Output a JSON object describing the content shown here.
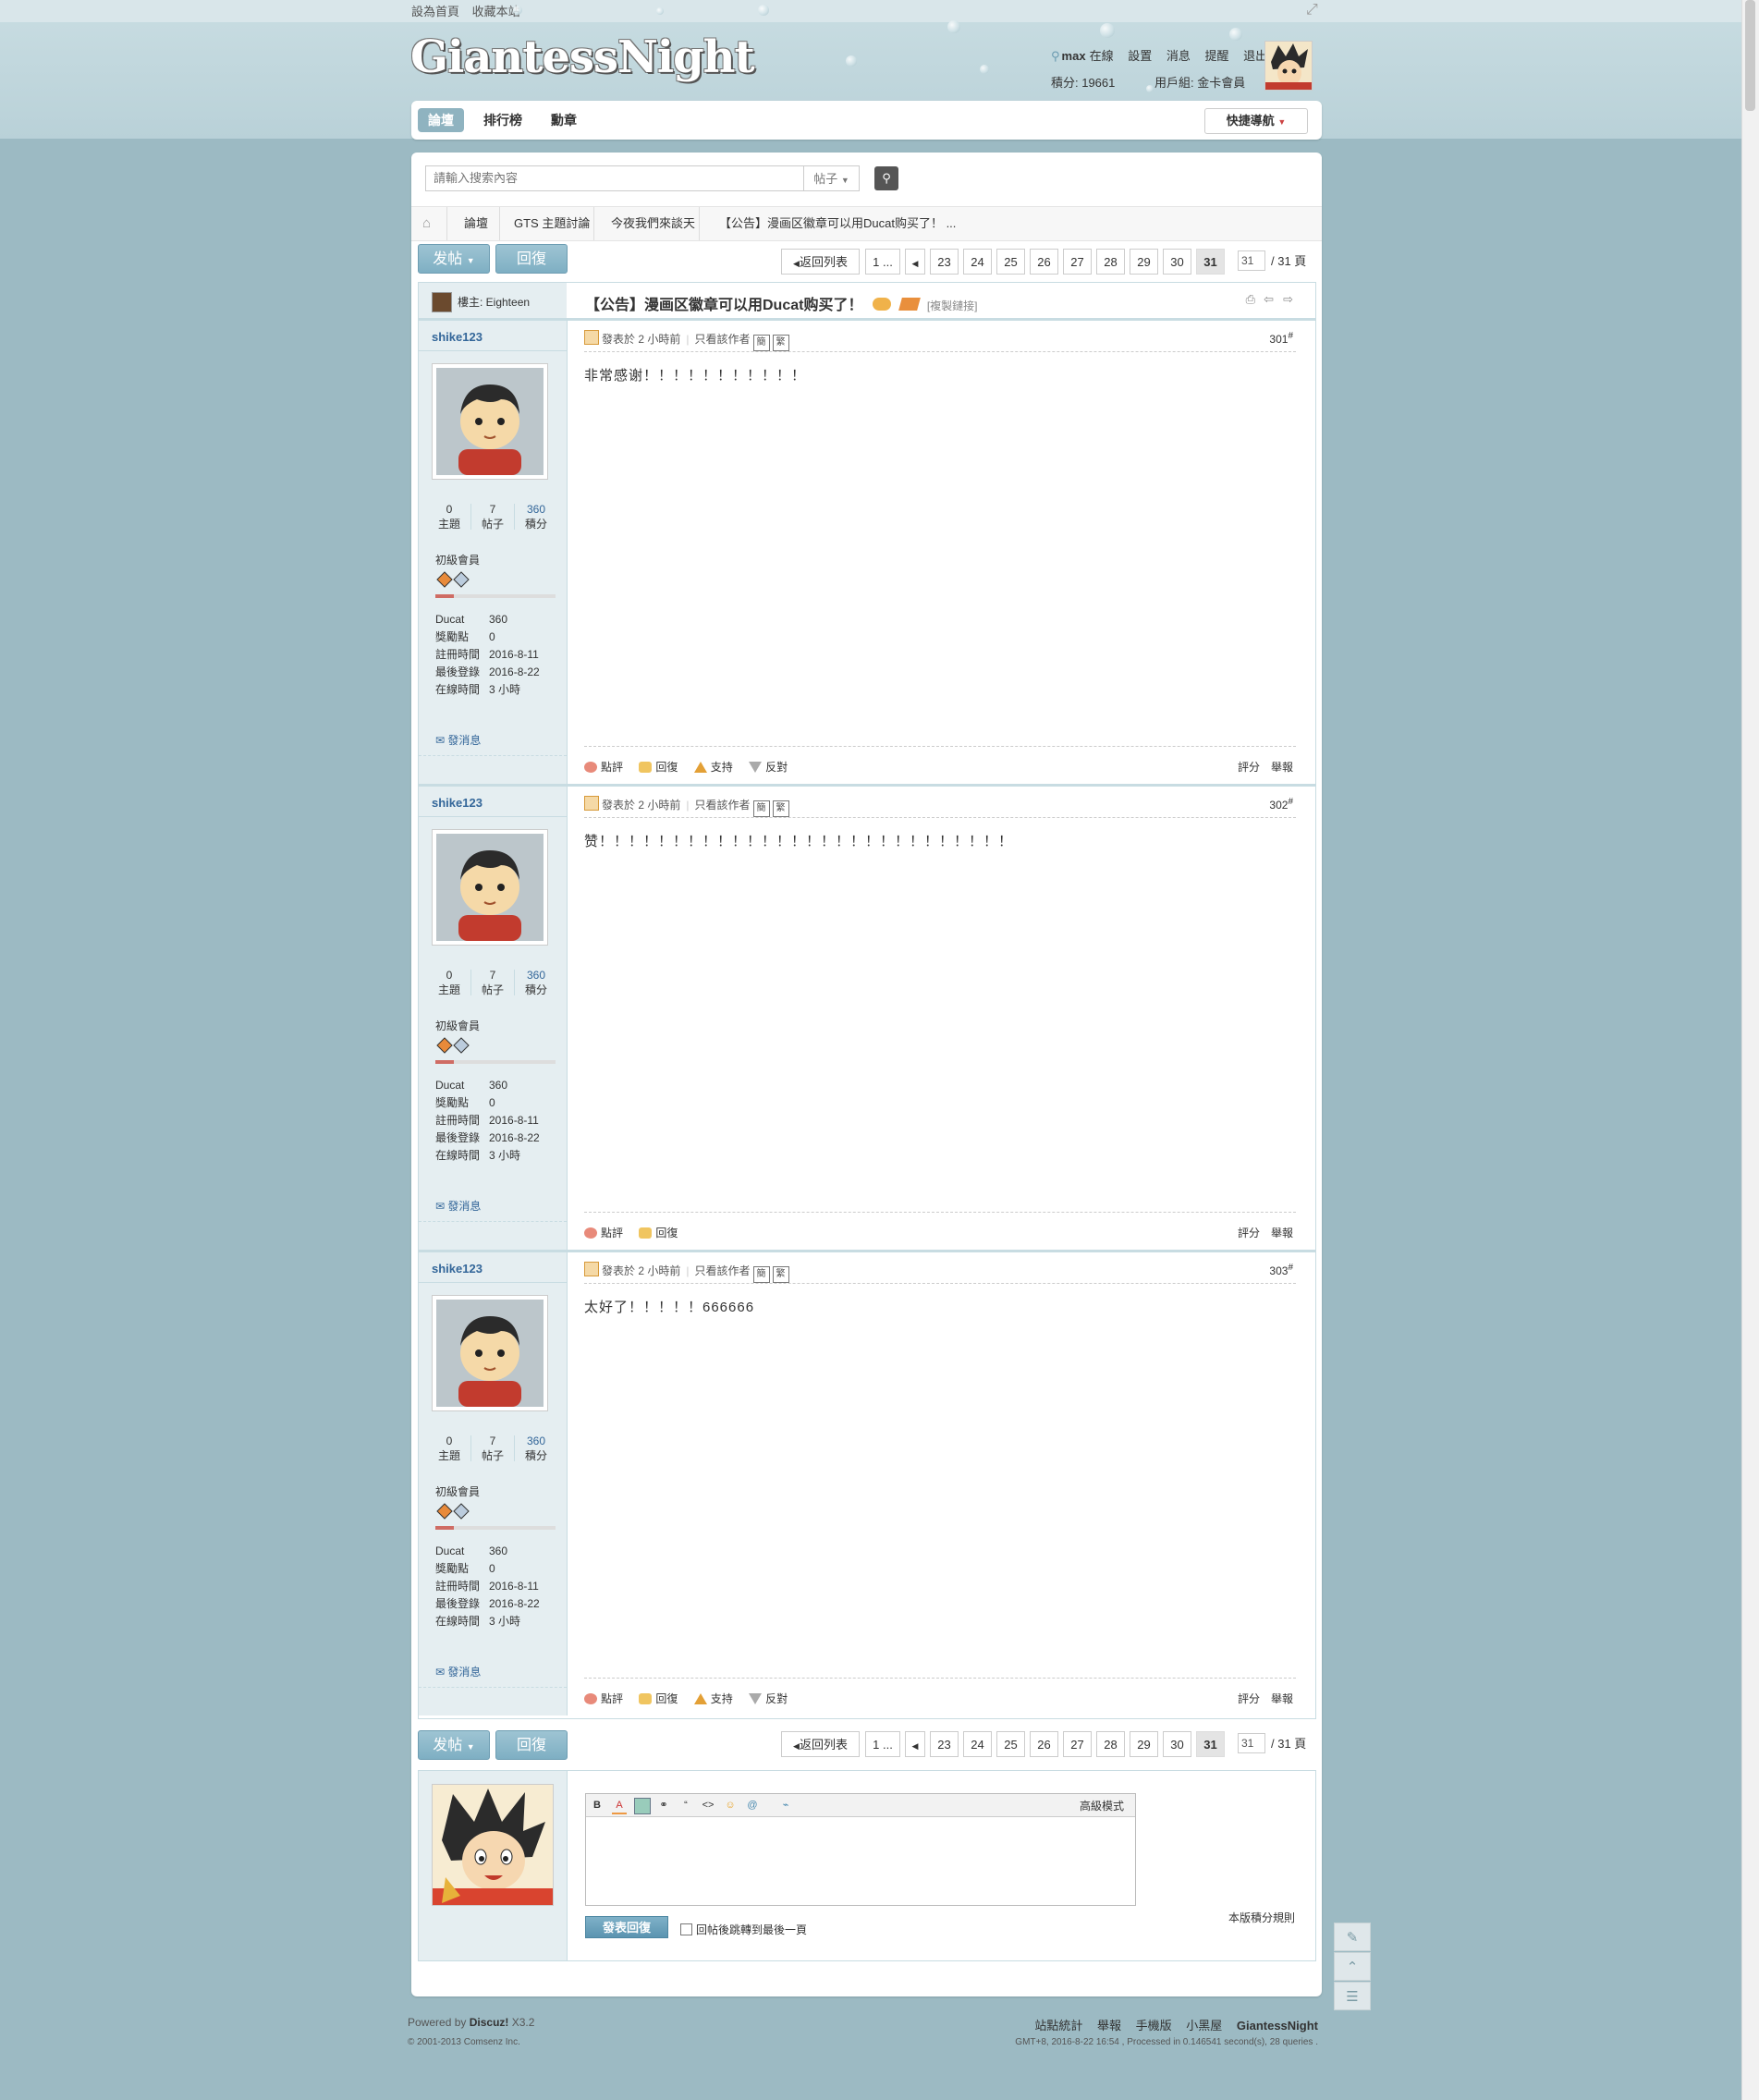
{
  "toplinks": [
    "設為首頁",
    "收藏本站"
  ],
  "site_logo": "GiantessNight",
  "user": {
    "name": "max",
    "status": "在線",
    "links": [
      "設置",
      "消息",
      "提醒",
      "退出"
    ],
    "credits": "積分: 19661",
    "group": "用戶組: 金卡會員"
  },
  "nav": {
    "tabs": [
      "論壇",
      "排行榜",
      "勳章"
    ],
    "quick_nav": "快捷導航"
  },
  "search": {
    "placeholder": "請輸入搜索內容",
    "type": "帖子"
  },
  "breadcrumb": [
    "論壇",
    "GTS 主題討論",
    "今夜我們來談天",
    "【公告】漫画区徽章可以用Ducat购买了！ ..."
  ],
  "buttons": {
    "post": "发帖",
    "reply": "回復"
  },
  "pager": {
    "back": "返回列表",
    "first": "1 ...",
    "pages": [
      "23",
      "24",
      "25",
      "26",
      "27",
      "28",
      "29",
      "30",
      "31"
    ],
    "current": "31",
    "input": "31",
    "total": "/ 31 頁"
  },
  "thread": {
    "host": "樓主: Eighteen",
    "title": "【公告】漫画区徽章可以用Ducat购买了！",
    "copy_link": "[複製鏈接]"
  },
  "posts": [
    {
      "author": "shike123",
      "stats": {
        "threads": "0",
        "threads_label": "主題",
        "posts": "7",
        "posts_label": "帖子",
        "credits": "360",
        "credits_label": "積分"
      },
      "rank": "初級會員",
      "info": [
        [
          "Ducat",
          "360"
        ],
        [
          "獎勵點",
          "0"
        ],
        [
          "註冊時間",
          "2016-8-11"
        ],
        [
          "最後登錄",
          "2016-8-22"
        ],
        [
          "在線時間",
          "3 小時"
        ]
      ],
      "send_msg": "發消息",
      "posted": "發表於",
      "time": "2 小時前",
      "only_author": "只看該作者",
      "simp": "簡",
      "trad": "繁",
      "floor": "301",
      "content": "非常感谢！！！！！！！！！！！",
      "actions": [
        "點評",
        "回復",
        "支持",
        "反對"
      ],
      "actions_right": [
        "評分",
        "舉報"
      ]
    },
    {
      "author": "shike123",
      "stats": {
        "threads": "0",
        "threads_label": "主題",
        "posts": "7",
        "posts_label": "帖子",
        "credits": "360",
        "credits_label": "積分"
      },
      "rank": "初級會員",
      "info": [
        [
          "Ducat",
          "360"
        ],
        [
          "獎勵點",
          "0"
        ],
        [
          "註冊時間",
          "2016-8-11"
        ],
        [
          "最後登錄",
          "2016-8-22"
        ],
        [
          "在線時間",
          "3 小時"
        ]
      ],
      "send_msg": "發消息",
      "posted": "發表於",
      "time": "2 小時前",
      "only_author": "只看該作者",
      "simp": "簡",
      "trad": "繁",
      "floor": "302",
      "content": "赞！！！！！！！！！！！！！！！！！！！！！！！！！！！！",
      "actions": [
        "點評",
        "回復"
      ],
      "actions_right": [
        "評分",
        "舉報"
      ]
    },
    {
      "author": "shike123",
      "stats": {
        "threads": "0",
        "threads_label": "主題",
        "posts": "7",
        "posts_label": "帖子",
        "credits": "360",
        "credits_label": "積分"
      },
      "rank": "初級會員",
      "info": [
        [
          "Ducat",
          "360"
        ],
        [
          "獎勵點",
          "0"
        ],
        [
          "註冊時間",
          "2016-8-11"
        ],
        [
          "最後登錄",
          "2016-8-22"
        ],
        [
          "在線時間",
          "3 小時"
        ]
      ],
      "send_msg": "發消息",
      "posted": "發表於",
      "time": "2 小時前",
      "only_author": "只看該作者",
      "simp": "簡",
      "trad": "繁",
      "floor": "303",
      "content": "太好了！！！！！666666",
      "actions": [
        "點評",
        "回復",
        "支持",
        "反對"
      ],
      "actions_right": [
        "評分",
        "舉報"
      ]
    }
  ],
  "reply": {
    "advanced": "高級模式",
    "submit": "發表回復",
    "jump_last": "回帖後跳轉到最後一頁",
    "credit_rule": "本版積分規則"
  },
  "footer": {
    "powered": "Powered by",
    "discuz": "Discuz!",
    "version": "X3.2",
    "copyright": "© 2001-2013 Comsenz Inc.",
    "links": [
      "站點統計",
      "舉報",
      "手機版",
      "小黑屋",
      "GiantessNight"
    ],
    "processed": "GMT+8, 2016-8-22 16:54 , Processed in 0.146541 second(s), 28 queries ."
  }
}
